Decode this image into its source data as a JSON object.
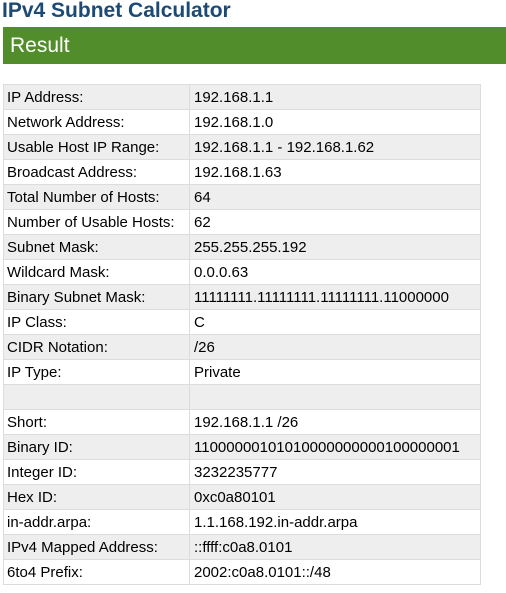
{
  "page": {
    "title": "IPv4 Subnet Calculator"
  },
  "result": {
    "heading": "Result"
  },
  "rows_main": [
    {
      "label": "IP Address:",
      "value": "192.168.1.1"
    },
    {
      "label": "Network Address:",
      "value": "192.168.1.0"
    },
    {
      "label": "Usable Host IP Range:",
      "value": "192.168.1.1 - 192.168.1.62"
    },
    {
      "label": "Broadcast Address:",
      "value": "192.168.1.63"
    },
    {
      "label": "Total Number of Hosts:",
      "value": "64"
    },
    {
      "label": "Number of Usable Hosts:",
      "value": "62"
    },
    {
      "label": "Subnet Mask:",
      "value": "255.255.255.192"
    },
    {
      "label": "Wildcard Mask:",
      "value": "0.0.0.63"
    },
    {
      "label": "Binary Subnet Mask:",
      "value": "11111111.11111111.11111111.11000000"
    },
    {
      "label": "IP Class:",
      "value": "C"
    },
    {
      "label": "CIDR Notation:",
      "value": "/26"
    },
    {
      "label": "IP Type:",
      "value": "Private"
    }
  ],
  "rows_extra": [
    {
      "label": "Short:",
      "value": "192.168.1.1 /26"
    },
    {
      "label": "Binary ID:",
      "value": "11000000101010000000000100000001"
    },
    {
      "label": "Integer ID:",
      "value": "3232235777"
    },
    {
      "label": "Hex ID:",
      "value": "0xc0a80101"
    },
    {
      "label": "in-addr.arpa:",
      "value": "1.1.168.192.in-addr.arpa"
    },
    {
      "label": "IPv4 Mapped Address:",
      "value": "::ffff:c0a8.0101"
    },
    {
      "label": "6to4 Prefix:",
      "value": "2002:c0a8.0101::/48"
    }
  ],
  "colors": {
    "title": "#1c4a75",
    "result_bar": "#518d2a",
    "row_shade": "#eeeeee",
    "border": "#dcdcdc"
  }
}
